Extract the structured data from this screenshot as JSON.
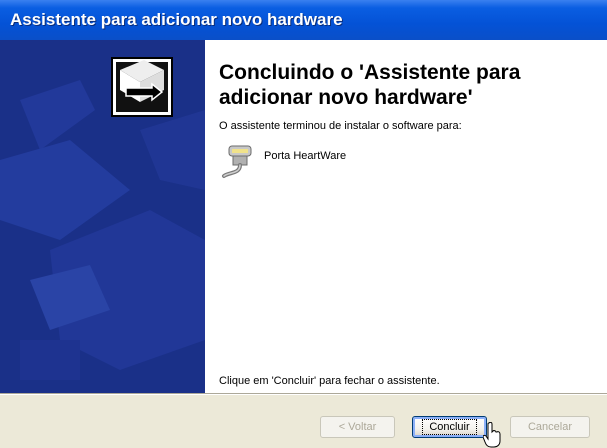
{
  "window": {
    "title": "Assistente para adicionar novo hardware"
  },
  "content": {
    "heading": "Concluindo o 'Assistente para adicionar novo hardware'",
    "subtitle": "O assistente terminou de instalar o software para:",
    "device": {
      "name": "Porta HeartWare",
      "icon": "serial-port-icon"
    },
    "finish_message": "Clique em 'Concluir' para fechar o assistente."
  },
  "buttons": {
    "back": {
      "label": "< Voltar",
      "enabled": false
    },
    "finish": {
      "label": "Concluir",
      "enabled": true,
      "default": true
    },
    "cancel": {
      "label": "Cancelar",
      "enabled": false
    }
  },
  "colors": {
    "titlebar": "#0452d6",
    "sidebar": "#1a3088",
    "buttonbar": "#ece9d8"
  },
  "cursor": {
    "icon": "hand-pointer-icon"
  }
}
